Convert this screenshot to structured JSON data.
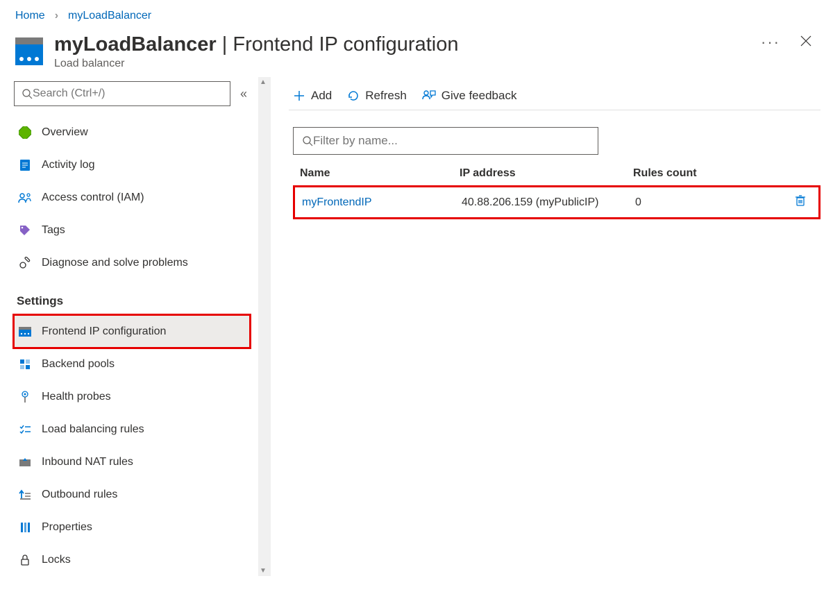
{
  "breadcrumb": {
    "home": "Home",
    "resource": "myLoadBalancer"
  },
  "header": {
    "title_strong": "myLoadBalancer",
    "title_rest": " | Frontend IP configuration",
    "subtitle": "Load balancer"
  },
  "sidebar": {
    "search_placeholder": "Search (Ctrl+/)",
    "items_top": [
      {
        "label": "Overview"
      },
      {
        "label": "Activity log"
      },
      {
        "label": "Access control (IAM)"
      },
      {
        "label": "Tags"
      },
      {
        "label": "Diagnose and solve problems"
      }
    ],
    "settings_label": "Settings",
    "items_settings": [
      {
        "label": "Frontend IP configuration",
        "selected": true
      },
      {
        "label": "Backend pools"
      },
      {
        "label": "Health probes"
      },
      {
        "label": "Load balancing rules"
      },
      {
        "label": "Inbound NAT rules"
      },
      {
        "label": "Outbound rules"
      },
      {
        "label": "Properties"
      },
      {
        "label": "Locks"
      }
    ]
  },
  "toolbar": {
    "add": "Add",
    "refresh": "Refresh",
    "feedback": "Give feedback"
  },
  "filter": {
    "placeholder": "Filter by name..."
  },
  "grid": {
    "headers": {
      "name": "Name",
      "ip": "IP address",
      "rules": "Rules count"
    },
    "rows": [
      {
        "name": "myFrontendIP",
        "ip": "40.88.206.159 (myPublicIP)",
        "rules": "0"
      }
    ]
  }
}
